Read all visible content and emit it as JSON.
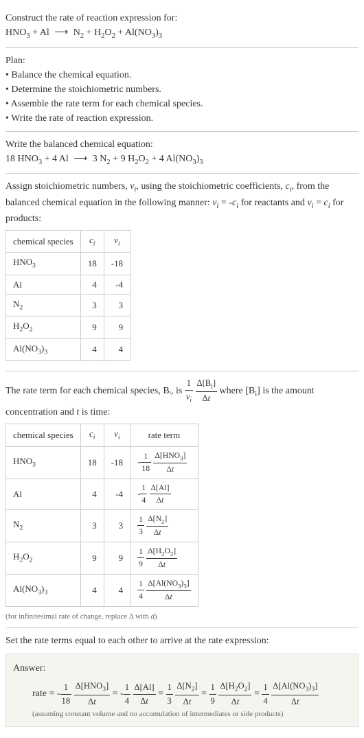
{
  "title": "Construct the rate of reaction expression for:",
  "equation_unbalanced": "HNO₃ + Al ⟶ N₂ + H₂O₂ + Al(NO₃)₃",
  "plan_header": "Plan:",
  "plan_items": [
    "• Balance the chemical equation.",
    "• Determine the stoichiometric numbers.",
    "• Assemble the rate term for each chemical species.",
    "• Write the rate of reaction expression."
  ],
  "balanced_header": "Write the balanced chemical equation:",
  "balanced_eq": "18 HNO₃ + 4 Al ⟶ 3 N₂ + 9 H₂O₂ + 4 Al(NO₃)₃",
  "assign_text_1": "Assign stoichiometric numbers, νᵢ, using the stoichiometric coefficients, cᵢ, from the balanced chemical equation in the following manner: νᵢ = -cᵢ for reactants and νᵢ = cᵢ for products:",
  "table1": {
    "headers": [
      "chemical species",
      "cᵢ",
      "νᵢ"
    ],
    "rows": [
      [
        "HNO₃",
        "18",
        "-18"
      ],
      [
        "Al",
        "4",
        "-4"
      ],
      [
        "N₂",
        "3",
        "3"
      ],
      [
        "H₂O₂",
        "9",
        "9"
      ],
      [
        "Al(NO₃)₃",
        "4",
        "4"
      ]
    ]
  },
  "rate_term_text_1": "The rate term for each chemical species, Bᵢ, is ",
  "rate_term_text_2": " where [Bᵢ] is the amount concentration and t is time:",
  "table2": {
    "headers": [
      "chemical species",
      "cᵢ",
      "νᵢ",
      "rate term"
    ],
    "rows": [
      {
        "species": "HNO₃",
        "ci": "18",
        "vi": "-18",
        "sign": "-",
        "coef_num": "1",
        "coef_den": "18",
        "delta": "Δ[HNO₃]"
      },
      {
        "species": "Al",
        "ci": "4",
        "vi": "-4",
        "sign": "-",
        "coef_num": "1",
        "coef_den": "4",
        "delta": "Δ[Al]"
      },
      {
        "species": "N₂",
        "ci": "3",
        "vi": "3",
        "sign": "",
        "coef_num": "1",
        "coef_den": "3",
        "delta": "Δ[N₂]"
      },
      {
        "species": "H₂O₂",
        "ci": "9",
        "vi": "9",
        "sign": "",
        "coef_num": "1",
        "coef_den": "9",
        "delta": "Δ[H₂O₂]"
      },
      {
        "species": "Al(NO₃)₃",
        "ci": "4",
        "vi": "4",
        "sign": "",
        "coef_num": "1",
        "coef_den": "4",
        "delta": "Δ[Al(NO₃)₃]"
      }
    ]
  },
  "infinitesimal_note": "(for infinitesimal rate of change, replace Δ with d)",
  "set_equal_text": "Set the rate terms equal to each other to arrive at the rate expression:",
  "answer_label": "Answer:",
  "answer_prefix": "rate = ",
  "answer_terms": [
    {
      "sign": "-",
      "num": "1",
      "den": "18",
      "delta": "Δ[HNO₃]"
    },
    {
      "sign": "-",
      "num": "1",
      "den": "4",
      "delta": "Δ[Al]"
    },
    {
      "sign": "",
      "num": "1",
      "den": "3",
      "delta": "Δ[N₂]"
    },
    {
      "sign": "",
      "num": "1",
      "den": "9",
      "delta": "Δ[H₂O₂]"
    },
    {
      "sign": "",
      "num": "1",
      "den": "4",
      "delta": "Δ[Al(NO₃)₃]"
    }
  ],
  "answer_note": "(assuming constant volume and no accumulation of intermediates or side products)",
  "delta_t": "Δt",
  "rate_frac_1_num": "1",
  "rate_frac_1_den": "νᵢ",
  "rate_frac_2_num": "Δ[Bᵢ]",
  "rate_frac_2_den": "Δt"
}
